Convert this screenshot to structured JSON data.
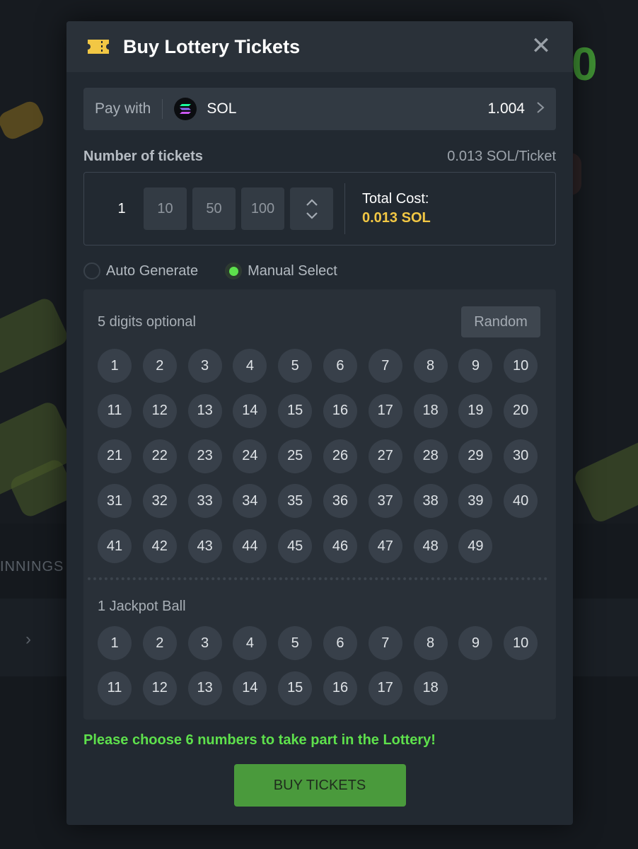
{
  "modal": {
    "title": "Buy Lottery Tickets"
  },
  "pay": {
    "label": "Pay with",
    "token": "SOL",
    "balance": "1.004"
  },
  "tickets": {
    "label": "Number of tickets",
    "price": "0.013 SOL/Ticket",
    "quantity": "1",
    "presets": [
      "10",
      "50",
      "100"
    ],
    "total_label": "Total Cost:",
    "total_value": "0.013 SOL"
  },
  "mode": {
    "auto_label": "Auto Generate",
    "manual_label": "Manual Select",
    "selected": "manual"
  },
  "main_balls": {
    "label": "5 digits optional",
    "random_label": "Random",
    "numbers": [
      "1",
      "2",
      "3",
      "4",
      "5",
      "6",
      "7",
      "8",
      "9",
      "10",
      "11",
      "12",
      "13",
      "14",
      "15",
      "16",
      "17",
      "18",
      "19",
      "20",
      "21",
      "22",
      "23",
      "24",
      "25",
      "26",
      "27",
      "28",
      "29",
      "30",
      "31",
      "32",
      "33",
      "34",
      "35",
      "36",
      "37",
      "38",
      "39",
      "40",
      "41",
      "42",
      "43",
      "44",
      "45",
      "46",
      "47",
      "48",
      "49"
    ]
  },
  "jackpot_balls": {
    "label": "1 Jackpot Ball",
    "numbers": [
      "1",
      "2",
      "3",
      "4",
      "5",
      "6",
      "7",
      "8",
      "9",
      "10",
      "11",
      "12",
      "13",
      "14",
      "15",
      "16",
      "17",
      "18"
    ]
  },
  "hint": "Please choose 6 numbers to take part in the Lottery!",
  "buy_label": "BUY TICKETS",
  "background": {
    "section_text": "INNINGS"
  },
  "colors": {
    "accent_green": "#5ee04c",
    "button_green": "#4a9a3c",
    "total_yellow": "#f2c744"
  }
}
